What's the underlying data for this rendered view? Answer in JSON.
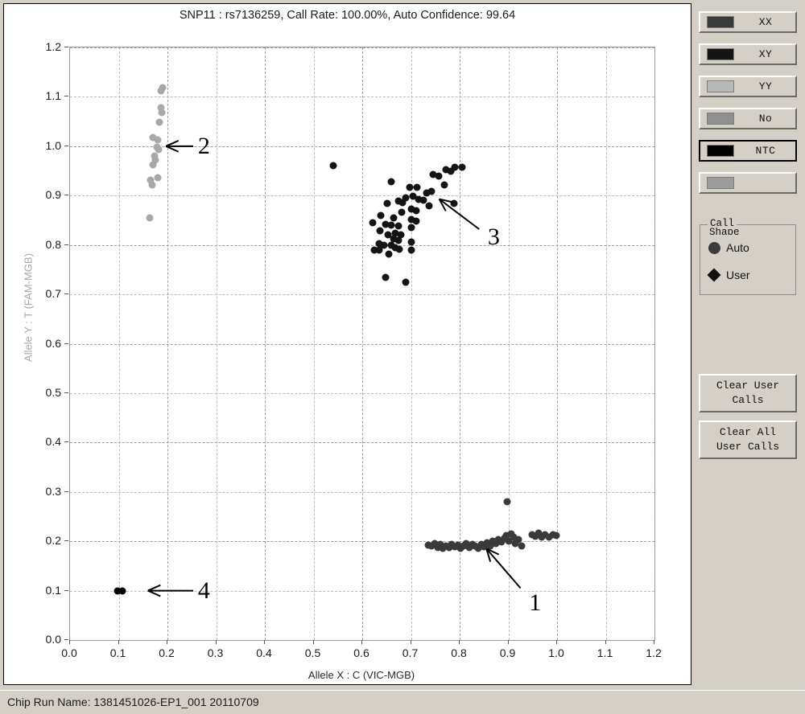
{
  "chart": {
    "title": "SNP11 : rs7136259, Call Rate: 100.00%, Auto Confidence: 99.64",
    "xaxis_title": "Allele X : C (VIC-MGB)",
    "yaxis_title": "Allele Y : T (FAM-MGB)"
  },
  "statusbar": {
    "text": "Chip Run Name: 1381451026-EP1_001 20110709"
  },
  "side_panel": {
    "call_buttons": [
      {
        "label": "XX",
        "color": "#3a3a3a",
        "selected": false
      },
      {
        "label": "XY",
        "color": "#141414",
        "selected": false
      },
      {
        "label": "YY",
        "color": "#b8b8b8",
        "selected": false
      },
      {
        "label": "No",
        "color": "#8f8f8f",
        "selected": false
      },
      {
        "label": "NTC",
        "color": "#000000",
        "selected": true
      },
      {
        "label": "",
        "color": "#9c9c9c",
        "selected": false
      }
    ],
    "call_shape": {
      "legend_line1": "Call",
      "legend_line2": "Shape",
      "rows": [
        {
          "label": "Auto",
          "shape": "circle"
        },
        {
          "label": "User",
          "shape": "diamond"
        }
      ]
    },
    "actions": [
      {
        "label": "Clear User\nCalls"
      },
      {
        "label": "Clear All\nUser Calls"
      }
    ]
  },
  "chart_data": {
    "type": "scatter",
    "title": "SNP11 : rs7136259, Call Rate: 100.00%, Auto Confidence: 99.64",
    "xlabel": "Allele X : C (VIC-MGB)",
    "ylabel": "Allele Y : T (FAM-MGB)",
    "xlim": [
      0.0,
      1.2
    ],
    "ylim": [
      0.0,
      1.2
    ],
    "xticks": [
      0.0,
      0.1,
      0.2,
      0.3,
      0.4,
      0.5,
      0.6,
      0.7,
      0.8,
      0.9,
      1.0,
      1.1,
      1.2
    ],
    "yticks": [
      0.0,
      0.1,
      0.2,
      0.3,
      0.4,
      0.5,
      0.6,
      0.7,
      0.8,
      0.9,
      1.0,
      1.1,
      1.2
    ],
    "grid": true,
    "legend_position": "right-panel",
    "marker_size_px": 9,
    "annotations": [
      {
        "label": "1",
        "text_x": 0.955,
        "text_y": 0.075,
        "arrow_from_x": 0.925,
        "arrow_from_y": 0.105,
        "arrow_to_x": 0.855,
        "arrow_to_y": 0.185,
        "cluster": "XX"
      },
      {
        "label": "2",
        "text_x": 0.275,
        "text_y": 1.0,
        "arrow_from_x": 0.253,
        "arrow_from_y": 1.0,
        "arrow_to_x": 0.197,
        "arrow_to_y": 1.0,
        "cluster": "YY"
      },
      {
        "label": "3",
        "text_x": 0.87,
        "text_y": 0.815,
        "arrow_from_x": 0.84,
        "arrow_from_y": 0.832,
        "arrow_to_x": 0.758,
        "arrow_to_y": 0.893,
        "cluster": "XY"
      },
      {
        "label": "4",
        "text_x": 0.275,
        "text_y": 0.1,
        "arrow_from_x": 0.253,
        "arrow_from_y": 0.1,
        "arrow_to_x": 0.16,
        "arrow_to_y": 0.1,
        "cluster": "NTC"
      }
    ],
    "series": [
      {
        "name": "YY",
        "call": "YY",
        "color": "#a8a8a8",
        "points": [
          [
            0.19,
            1.118
          ],
          [
            0.186,
            1.112
          ],
          [
            0.186,
            1.078
          ],
          [
            0.189,
            1.068
          ],
          [
            0.183,
            1.048
          ],
          [
            0.17,
            1.018
          ],
          [
            0.18,
            1.012
          ],
          [
            0.178,
            0.998
          ],
          [
            0.182,
            0.993
          ],
          [
            0.174,
            0.98
          ],
          [
            0.176,
            0.972
          ],
          [
            0.17,
            0.962
          ],
          [
            0.165,
            0.932
          ],
          [
            0.18,
            0.936
          ],
          [
            0.168,
            0.922
          ],
          [
            0.163,
            0.855
          ]
        ]
      },
      {
        "name": "XY",
        "call": "XY",
        "color": "#141414",
        "points": [
          [
            0.54,
            0.96
          ],
          [
            0.79,
            0.958
          ],
          [
            0.805,
            0.957
          ],
          [
            0.772,
            0.952
          ],
          [
            0.782,
            0.95
          ],
          [
            0.746,
            0.942
          ],
          [
            0.757,
            0.94
          ],
          [
            0.66,
            0.928
          ],
          [
            0.768,
            0.922
          ],
          [
            0.698,
            0.916
          ],
          [
            0.712,
            0.917
          ],
          [
            0.732,
            0.906
          ],
          [
            0.742,
            0.908
          ],
          [
            0.704,
            0.898
          ],
          [
            0.69,
            0.896
          ],
          [
            0.716,
            0.893
          ],
          [
            0.726,
            0.89
          ],
          [
            0.675,
            0.889
          ],
          [
            0.683,
            0.886
          ],
          [
            0.652,
            0.884
          ],
          [
            0.788,
            0.884
          ],
          [
            0.737,
            0.88
          ],
          [
            0.7,
            0.872
          ],
          [
            0.71,
            0.87
          ],
          [
            0.681,
            0.867
          ],
          [
            0.638,
            0.86
          ],
          [
            0.664,
            0.855
          ],
          [
            0.7,
            0.852
          ],
          [
            0.71,
            0.848
          ],
          [
            0.622,
            0.845
          ],
          [
            0.648,
            0.841
          ],
          [
            0.66,
            0.84
          ],
          [
            0.674,
            0.838
          ],
          [
            0.7,
            0.835
          ],
          [
            0.637,
            0.828
          ],
          [
            0.668,
            0.824
          ],
          [
            0.653,
            0.82
          ],
          [
            0.68,
            0.82
          ],
          [
            0.665,
            0.812
          ],
          [
            0.675,
            0.809
          ],
          [
            0.7,
            0.806
          ],
          [
            0.634,
            0.802
          ],
          [
            0.644,
            0.8
          ],
          [
            0.66,
            0.8
          ],
          [
            0.667,
            0.795
          ],
          [
            0.676,
            0.792
          ],
          [
            0.624,
            0.79
          ],
          [
            0.634,
            0.789
          ],
          [
            0.7,
            0.79
          ],
          [
            0.655,
            0.782
          ],
          [
            0.648,
            0.735
          ],
          [
            0.69,
            0.725
          ]
        ]
      },
      {
        "name": "XX",
        "call": "XX",
        "color": "#3a3a3a",
        "points": [
          [
            0.735,
            0.192
          ],
          [
            0.742,
            0.19
          ],
          [
            0.748,
            0.196
          ],
          [
            0.755,
            0.188
          ],
          [
            0.76,
            0.193
          ],
          [
            0.766,
            0.186
          ],
          [
            0.772,
            0.191
          ],
          [
            0.778,
            0.187
          ],
          [
            0.784,
            0.194
          ],
          [
            0.79,
            0.189
          ],
          [
            0.796,
            0.192
          ],
          [
            0.802,
            0.186
          ],
          [
            0.808,
            0.19
          ],
          [
            0.814,
            0.196
          ],
          [
            0.82,
            0.188
          ],
          [
            0.826,
            0.193
          ],
          [
            0.832,
            0.19
          ],
          [
            0.838,
            0.186
          ],
          [
            0.844,
            0.194
          ],
          [
            0.85,
            0.189
          ],
          [
            0.856,
            0.197
          ],
          [
            0.862,
            0.191
          ],
          [
            0.868,
            0.2
          ],
          [
            0.874,
            0.195
          ],
          [
            0.88,
            0.204
          ],
          [
            0.886,
            0.198
          ],
          [
            0.892,
            0.206
          ],
          [
            0.896,
            0.212
          ],
          [
            0.9,
            0.201
          ],
          [
            0.905,
            0.215
          ],
          [
            0.91,
            0.208
          ],
          [
            0.914,
            0.196
          ],
          [
            0.92,
            0.203
          ],
          [
            0.928,
            0.19
          ],
          [
            0.898,
            0.28
          ],
          [
            0.948,
            0.214
          ],
          [
            0.955,
            0.21
          ],
          [
            0.962,
            0.216
          ],
          [
            0.968,
            0.208
          ],
          [
            0.976,
            0.213
          ],
          [
            0.984,
            0.209
          ],
          [
            0.992,
            0.214
          ],
          [
            0.998,
            0.211
          ]
        ]
      },
      {
        "name": "NTC",
        "call": "NTC",
        "color": "#000000",
        "points": [
          [
            0.097,
            0.1
          ],
          [
            0.108,
            0.1
          ]
        ]
      }
    ]
  }
}
